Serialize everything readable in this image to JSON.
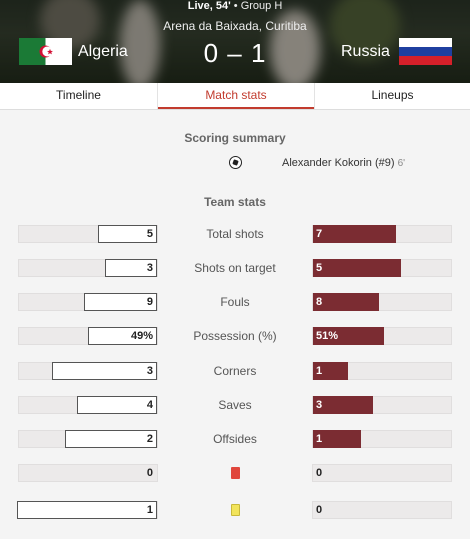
{
  "match": {
    "status_live": "Live, 54'",
    "status_sep": " • ",
    "group": "Group H",
    "venue": "Arena da Baixada, Curitiba",
    "home_team": "Algeria",
    "away_team": "Russia",
    "score": "0 – 1",
    "home_flag_icon": "algeria-flag-icon",
    "away_flag_icon": "russia-flag-icon"
  },
  "tabs": [
    {
      "label": "Timeline",
      "active": false
    },
    {
      "label": "Match stats",
      "active": true
    },
    {
      "label": "Lineups",
      "active": false
    }
  ],
  "scoring": {
    "title": "Scoring summary",
    "goals": [
      {
        "icon": "soccer-ball-icon",
        "scorer": "Alexander Kokorin (#9)",
        "minute": "6'"
      }
    ]
  },
  "team_stats": {
    "title": "Team stats",
    "rows": [
      {
        "label": "Total shots",
        "home": "5",
        "away": "7",
        "home_fill": 0.42,
        "away_fill": 0.59
      },
      {
        "label": "Shots on target",
        "home": "3",
        "away": "5",
        "home_fill": 0.37,
        "away_fill": 0.63
      },
      {
        "label": "Fouls",
        "home": "9",
        "away": "8",
        "home_fill": 0.52,
        "away_fill": 0.47
      },
      {
        "label": "Possession (%)",
        "home": "49%",
        "away": "51%",
        "home_fill": 0.49,
        "away_fill": 0.51
      },
      {
        "label": "Corners",
        "home": "3",
        "away": "1",
        "home_fill": 0.75,
        "away_fill": 0.25
      },
      {
        "label": "Saves",
        "home": "4",
        "away": "3",
        "home_fill": 0.57,
        "away_fill": 0.43
      },
      {
        "label": "Offsides",
        "home": "2",
        "away": "1",
        "home_fill": 0.66,
        "away_fill": 0.34
      },
      {
        "label": "",
        "icon": "red-card-icon",
        "home": "0",
        "away": "0",
        "home_fill": 0,
        "away_fill": 0
      },
      {
        "label": "",
        "icon": "yellow-card-icon",
        "home": "1",
        "away": "0",
        "home_fill": 1.0,
        "away_fill": 0
      }
    ]
  },
  "colors": {
    "accent": "#c23b2e",
    "away_bar": "#7b2c32"
  }
}
